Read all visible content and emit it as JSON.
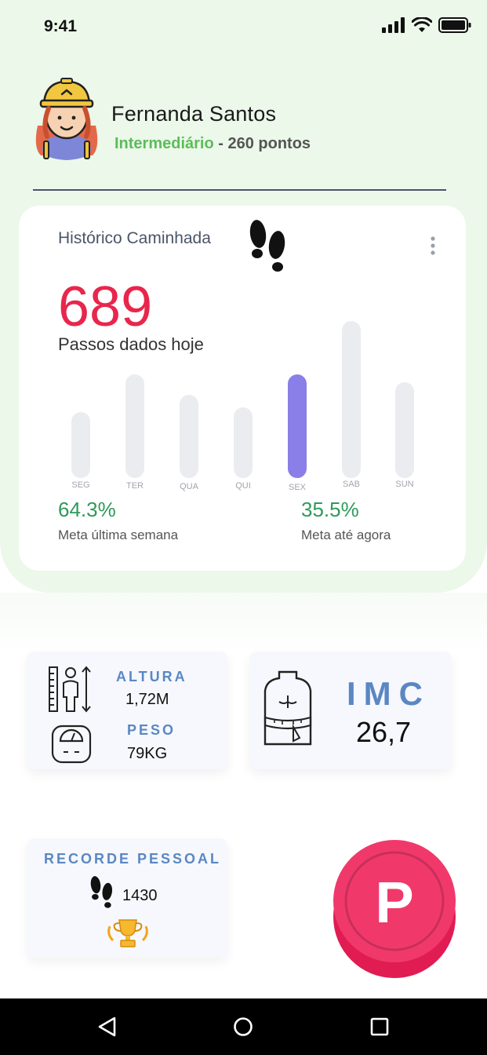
{
  "status_bar": {
    "time": "9:41"
  },
  "profile": {
    "name": "Fernanda Santos",
    "level": "Intermediário",
    "points": " - 260 pontos"
  },
  "walk_card": {
    "title": "Histórico Caminhada",
    "steps_today": "689",
    "steps_caption": "Passos dados hoje",
    "chart_data": {
      "type": "bar",
      "categories": [
        "SEG",
        "TER",
        "QUA",
        "QUI",
        "SEX",
        "SAB",
        "SUN"
      ],
      "values": [
        42,
        66,
        53,
        45,
        66,
        100,
        61
      ],
      "highlight_index": 4,
      "highlight_color": "#8a7ee8",
      "bar_color": "#ebecf0"
    },
    "goal_last_week_value": "64.3%",
    "goal_last_week_caption": "Meta última semana",
    "goal_so_far_value": "35.5%",
    "goal_so_far_caption": "Meta até agora"
  },
  "body_tile": {
    "height_label": "ALTURA",
    "height_value": "1,72M",
    "weight_label": "PESO",
    "weight_value": "79KG"
  },
  "imc_tile": {
    "label": "IMC",
    "value": "26,7"
  },
  "record_tile": {
    "label": "RECORDE PESSOAL",
    "value": "1430"
  },
  "fab": {
    "label": "P",
    "color": "#f0396a"
  },
  "colors": {
    "accent_red": "#e8264c",
    "accent_green": "#2e9a5a",
    "accent_blue": "#5b87c3",
    "level_green": "#5cbd5a"
  }
}
